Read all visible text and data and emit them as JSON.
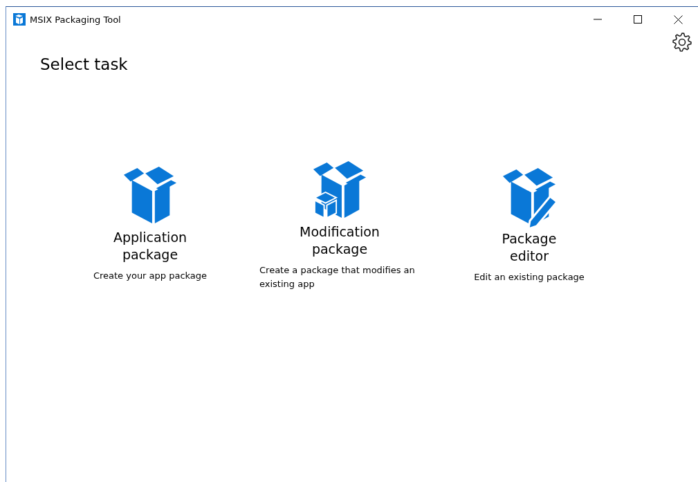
{
  "window": {
    "title": "MSIX Packaging Tool"
  },
  "heading": "Select task",
  "tasks": [
    {
      "kind": "new",
      "title": "Application package",
      "description": "Create your app package"
    },
    {
      "kind": "modify",
      "title": "Modification package",
      "description": "Create a package that modifies an existing app"
    },
    {
      "kind": "edit",
      "title": "Package editor",
      "description": "Edit an existing package"
    }
  ]
}
